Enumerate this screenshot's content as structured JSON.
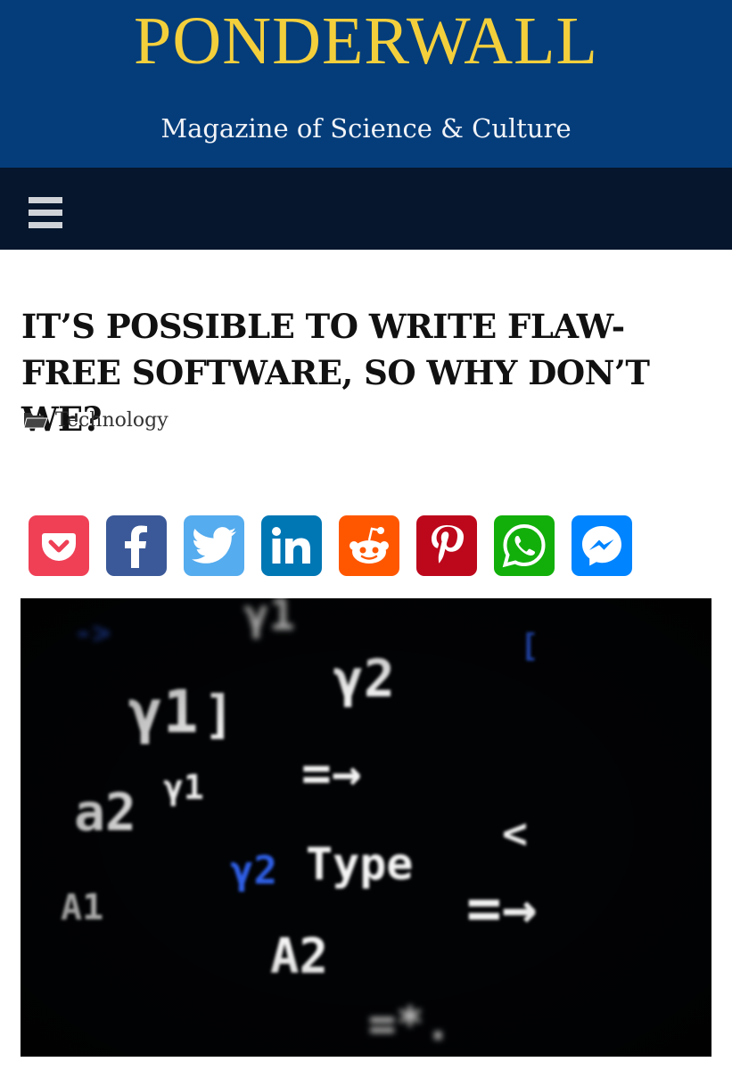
{
  "site": {
    "title": "PONDERWALL",
    "tagline": "Magazine of Science & Culture"
  },
  "colors": {
    "masthead": "#053d7a",
    "title": "#f4cf3c",
    "navbar": "#06162c"
  },
  "nav": {
    "menu_icon": "hamburger-menu-icon"
  },
  "post": {
    "title": "IT’S POSSIBLE TO WRITE FLAW-FREE SOFTWARE, SO WHY DON’T WE?",
    "category_icon": "folder-icon",
    "category": "Technology"
  },
  "share": [
    {
      "network": "pocket",
      "color": "#ef4056"
    },
    {
      "network": "facebook",
      "color": "#3b5998"
    },
    {
      "network": "twitter",
      "color": "#55acee"
    },
    {
      "network": "linkedin",
      "color": "#0077b5"
    },
    {
      "network": "reddit",
      "color": "#ff5700"
    },
    {
      "network": "pinterest",
      "color": "#bd081c"
    },
    {
      "network": "whatsapp",
      "color": "#12af0a"
    },
    {
      "network": "messenger",
      "color": "#0084ff"
    }
  ],
  "hero_image": {
    "glyphs": [
      "->",
      "γ1",
      "[",
      "γ1",
      "]",
      "γ2",
      "=→",
      "γ1",
      "a2",
      "<",
      "γ2",
      "Type",
      "=→",
      "A1",
      "A2",
      "=*."
    ]
  }
}
